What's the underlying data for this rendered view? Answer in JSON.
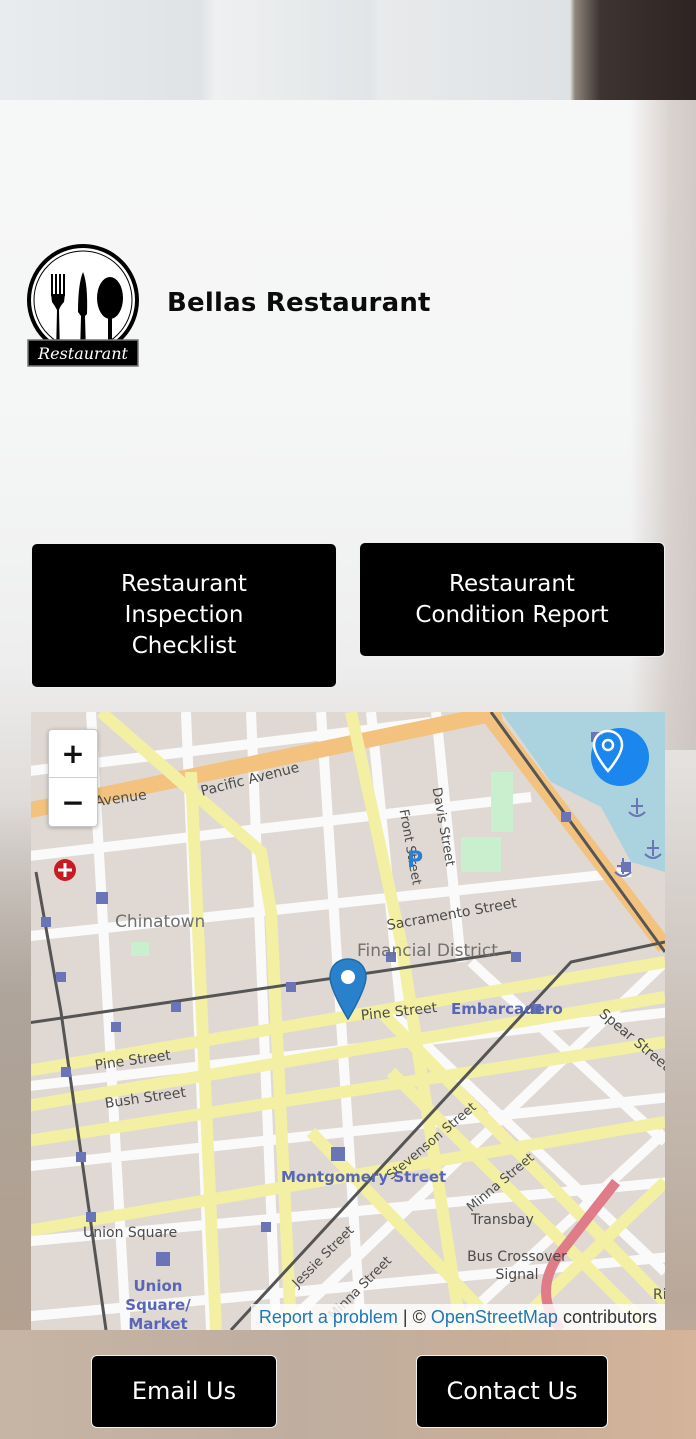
{
  "header": {
    "brand_name": "Bellas Restaurant",
    "logo_text": "Restaurant"
  },
  "actions": {
    "checklist": {
      "lines": [
        "Restaurant",
        "Inspection",
        "Checklist"
      ]
    },
    "condition_report": {
      "lines": [
        "Restaurant",
        "Condition Report"
      ]
    }
  },
  "map": {
    "zoom_in_label": "+",
    "zoom_out_label": "−",
    "locate_icon": "map-pin-icon",
    "marker_icon": "map-marker-icon",
    "labels": {
      "pacific_avenue_left": "c Avenue",
      "pacific_avenue": "Pacific Avenue",
      "front_street": "Front Street",
      "davis_street": "Davis Street",
      "chinatown": "Chinatown",
      "sacramento_street": "Sacramento Street",
      "financial_district": "Financial District",
      "pine_street_right": "Pine Street",
      "embarcadero": "Embarcadero",
      "spear_street": "Spear Street",
      "pine_street_left": "Pine Street",
      "bush_street": "Bush Street",
      "stevenson_street": "Stevenson Street",
      "montgomery_street": "Montgomery Street",
      "minna_street_upper": "Minna Street",
      "transbay": "Transbay",
      "union_square": "Union Square",
      "jessie_street": "Jessie Street",
      "bus_crossover_signal": "Bus Crossover Signal",
      "minna_street_lower": "Minna Street",
      "union_square_market": "Union Square/ Market",
      "rincon": "Rinco",
      "parking": "P"
    },
    "attribution": {
      "report_link": "Report a problem",
      "separator": " | © ",
      "osm_link": "OpenStreetMap",
      "suffix": " contributors"
    }
  },
  "footer": {
    "email_label": "Email Us",
    "contact_label": "Contact Us"
  },
  "colors": {
    "button_bg": "#000000",
    "button_text": "#ffffff",
    "locate_button": "#1a86ee",
    "marker": "#2a81cb",
    "attribution_link": "#1d78b5"
  }
}
